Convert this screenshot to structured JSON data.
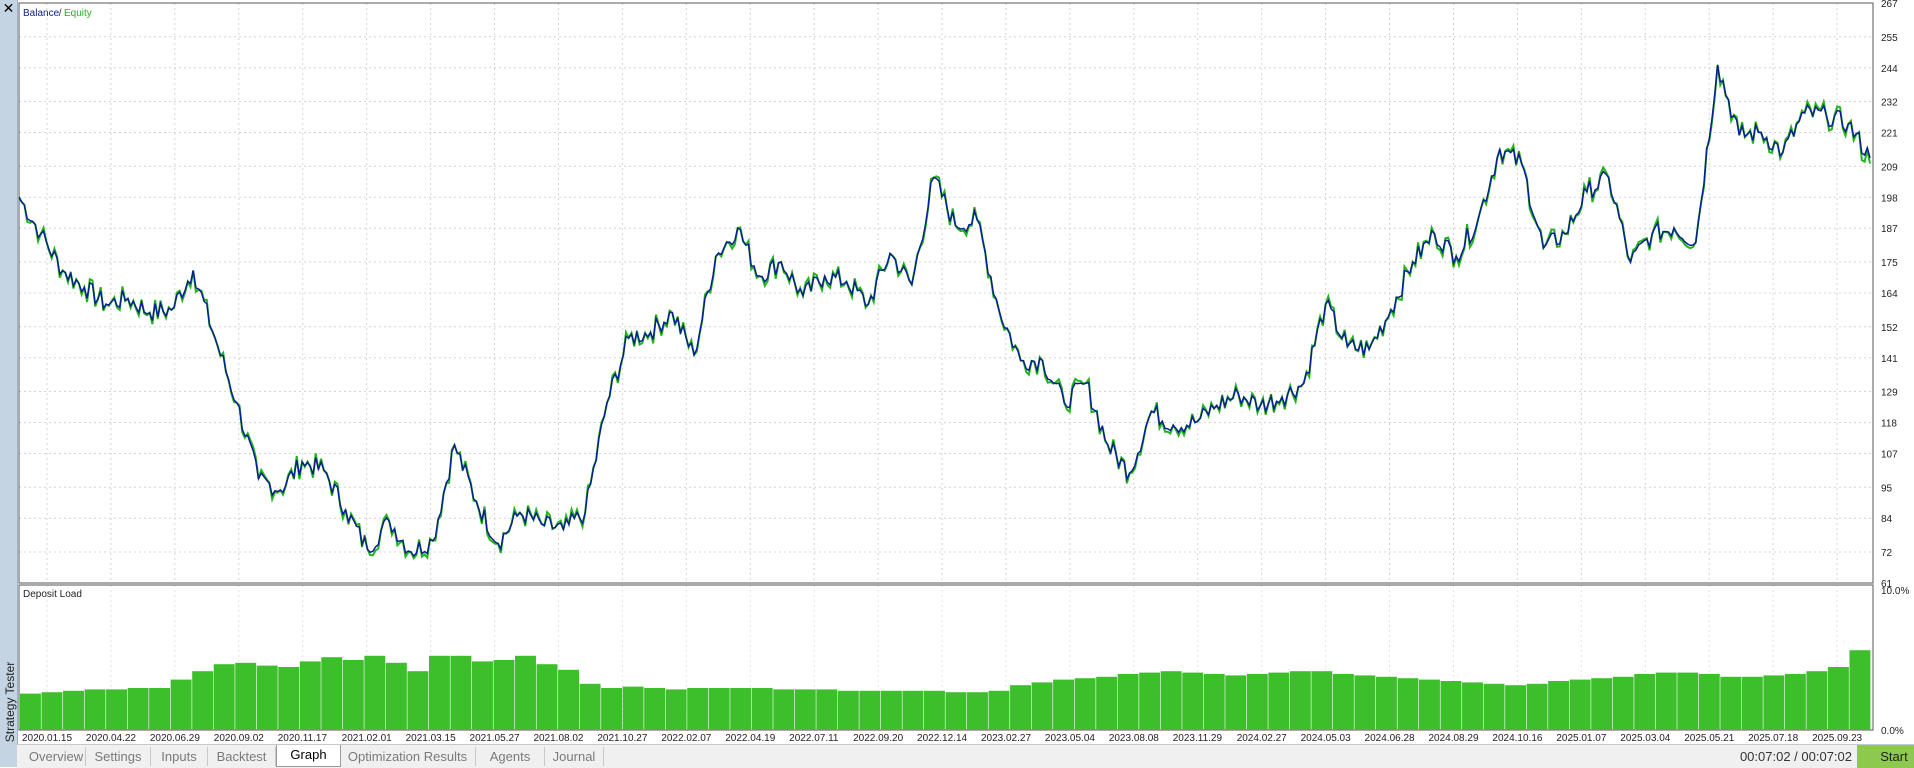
{
  "window": {
    "panel_title": "Strategy Tester"
  },
  "tabs": [
    {
      "label": "Overview",
      "active": false
    },
    {
      "label": "Settings",
      "active": false
    },
    {
      "label": "Inputs",
      "active": false
    },
    {
      "label": "Backtest",
      "active": false
    },
    {
      "label": "Graph",
      "active": true
    },
    {
      "label": "Optimization Results",
      "active": false
    },
    {
      "label": "Agents",
      "active": false
    },
    {
      "label": "Journal",
      "active": false
    }
  ],
  "status": {
    "elapsed": "00:07:02 / 00:07:02",
    "start_label": "Start"
  },
  "colors": {
    "balance": "#0a1f8f",
    "equity": "#22b41e",
    "deposit_load": "#3cbf2a",
    "grid": "#d0d0d0"
  },
  "chart_data": [
    {
      "type": "line",
      "legend": {
        "balance_label": "Balance",
        "separator": " / ",
        "equity_label": "Equity"
      },
      "ylim": [
        61,
        267
      ],
      "yticks": [
        "267",
        "255",
        "244",
        "232",
        "221",
        "209",
        "198",
        "187",
        "175",
        "164",
        "152",
        "141",
        "129",
        "118",
        "107",
        "95",
        "84",
        "72",
        "61"
      ],
      "x_labels": [
        "2020.01.15",
        "2020.04.22",
        "2020.06.29",
        "2020.09.02",
        "2020.11.17",
        "2021.02.01",
        "2021.03.15",
        "2021.05.27",
        "2021.08.02",
        "2021.10.27",
        "2022.02.07",
        "2022.04.19",
        "2022.07.11",
        "2022.09.20",
        "2022.12.14",
        "2023.02.27",
        "2023.05.04",
        "2023.08.08",
        "2023.11.29",
        "2024.02.27",
        "2024.05.03",
        "2024.06.28",
        "2024.08.29",
        "2024.10.16",
        "2025.01.07",
        "2025.03.04",
        "2025.05.21",
        "2025.07.18",
        "2025.09.23"
      ],
      "series": [
        {
          "name": "Balance",
          "values": [
            198,
            185,
            172,
            166,
            160,
            162,
            157,
            158,
            172,
            148,
            125,
            98,
            94,
            104,
            101,
            87,
            73,
            83,
            72,
            76,
            110,
            90,
            75,
            86,
            82,
            80,
            86,
            125,
            148,
            150,
            157,
            142,
            177,
            187,
            170,
            175,
            163,
            170,
            168,
            160,
            178,
            167,
            205,
            188,
            190,
            158,
            140,
            140,
            125,
            132,
            110,
            100,
            122,
            117,
            118,
            124,
            128,
            124,
            127,
            132,
            160,
            145,
            144,
            158,
            175,
            185,
            177,
            190,
            215,
            210,
            180,
            185,
            200,
            205,
            175,
            185,
            187,
            182,
            245,
            220,
            221,
            214,
            228,
            227,
            224,
            212
          ]
        },
        {
          "name": "Equity",
          "values": [
            198,
            185,
            172,
            166,
            160,
            162,
            157,
            158,
            172,
            148,
            125,
            98,
            94,
            104,
            101,
            87,
            73,
            83,
            72,
            76,
            110,
            90,
            75,
            86,
            82,
            80,
            86,
            125,
            148,
            150,
            157,
            142,
            177,
            187,
            170,
            175,
            163,
            170,
            168,
            160,
            178,
            167,
            205,
            188,
            190,
            158,
            140,
            140,
            125,
            132,
            110,
            100,
            122,
            117,
            118,
            124,
            128,
            124,
            127,
            132,
            160,
            145,
            144,
            158,
            175,
            185,
            177,
            190,
            215,
            210,
            180,
            185,
            200,
            205,
            175,
            185,
            187,
            182,
            245,
            220,
            221,
            214,
            228,
            227,
            224,
            210
          ]
        }
      ]
    },
    {
      "type": "bar",
      "title": "Deposit Load",
      "ylim": [
        0,
        10
      ],
      "yticks": [
        "10.0%",
        "0.0%"
      ],
      "values": [
        2.6,
        2.7,
        2.8,
        2.9,
        2.9,
        3.0,
        3.0,
        3.6,
        4.2,
        4.7,
        4.8,
        4.6,
        4.5,
        4.9,
        5.2,
        5.0,
        5.3,
        4.8,
        4.2,
        5.3,
        5.3,
        4.9,
        5.0,
        5.3,
        4.7,
        4.3,
        3.3,
        3.0,
        3.1,
        3.0,
        2.9,
        3.0,
        3.0,
        3.0,
        3.0,
        2.9,
        2.9,
        2.9,
        2.8,
        2.8,
        2.8,
        2.8,
        2.8,
        2.7,
        2.7,
        2.8,
        3.2,
        3.4,
        3.6,
        3.7,
        3.8,
        4.0,
        4.1,
        4.2,
        4.1,
        4.0,
        3.9,
        4.0,
        4.1,
        4.2,
        4.2,
        4.0,
        3.9,
        3.8,
        3.7,
        3.6,
        3.5,
        3.4,
        3.3,
        3.2,
        3.3,
        3.5,
        3.6,
        3.7,
        3.8,
        4.0,
        4.1,
        4.1,
        4.0,
        3.8,
        3.8,
        3.9,
        4.0,
        4.2,
        4.5,
        5.7
      ]
    }
  ]
}
